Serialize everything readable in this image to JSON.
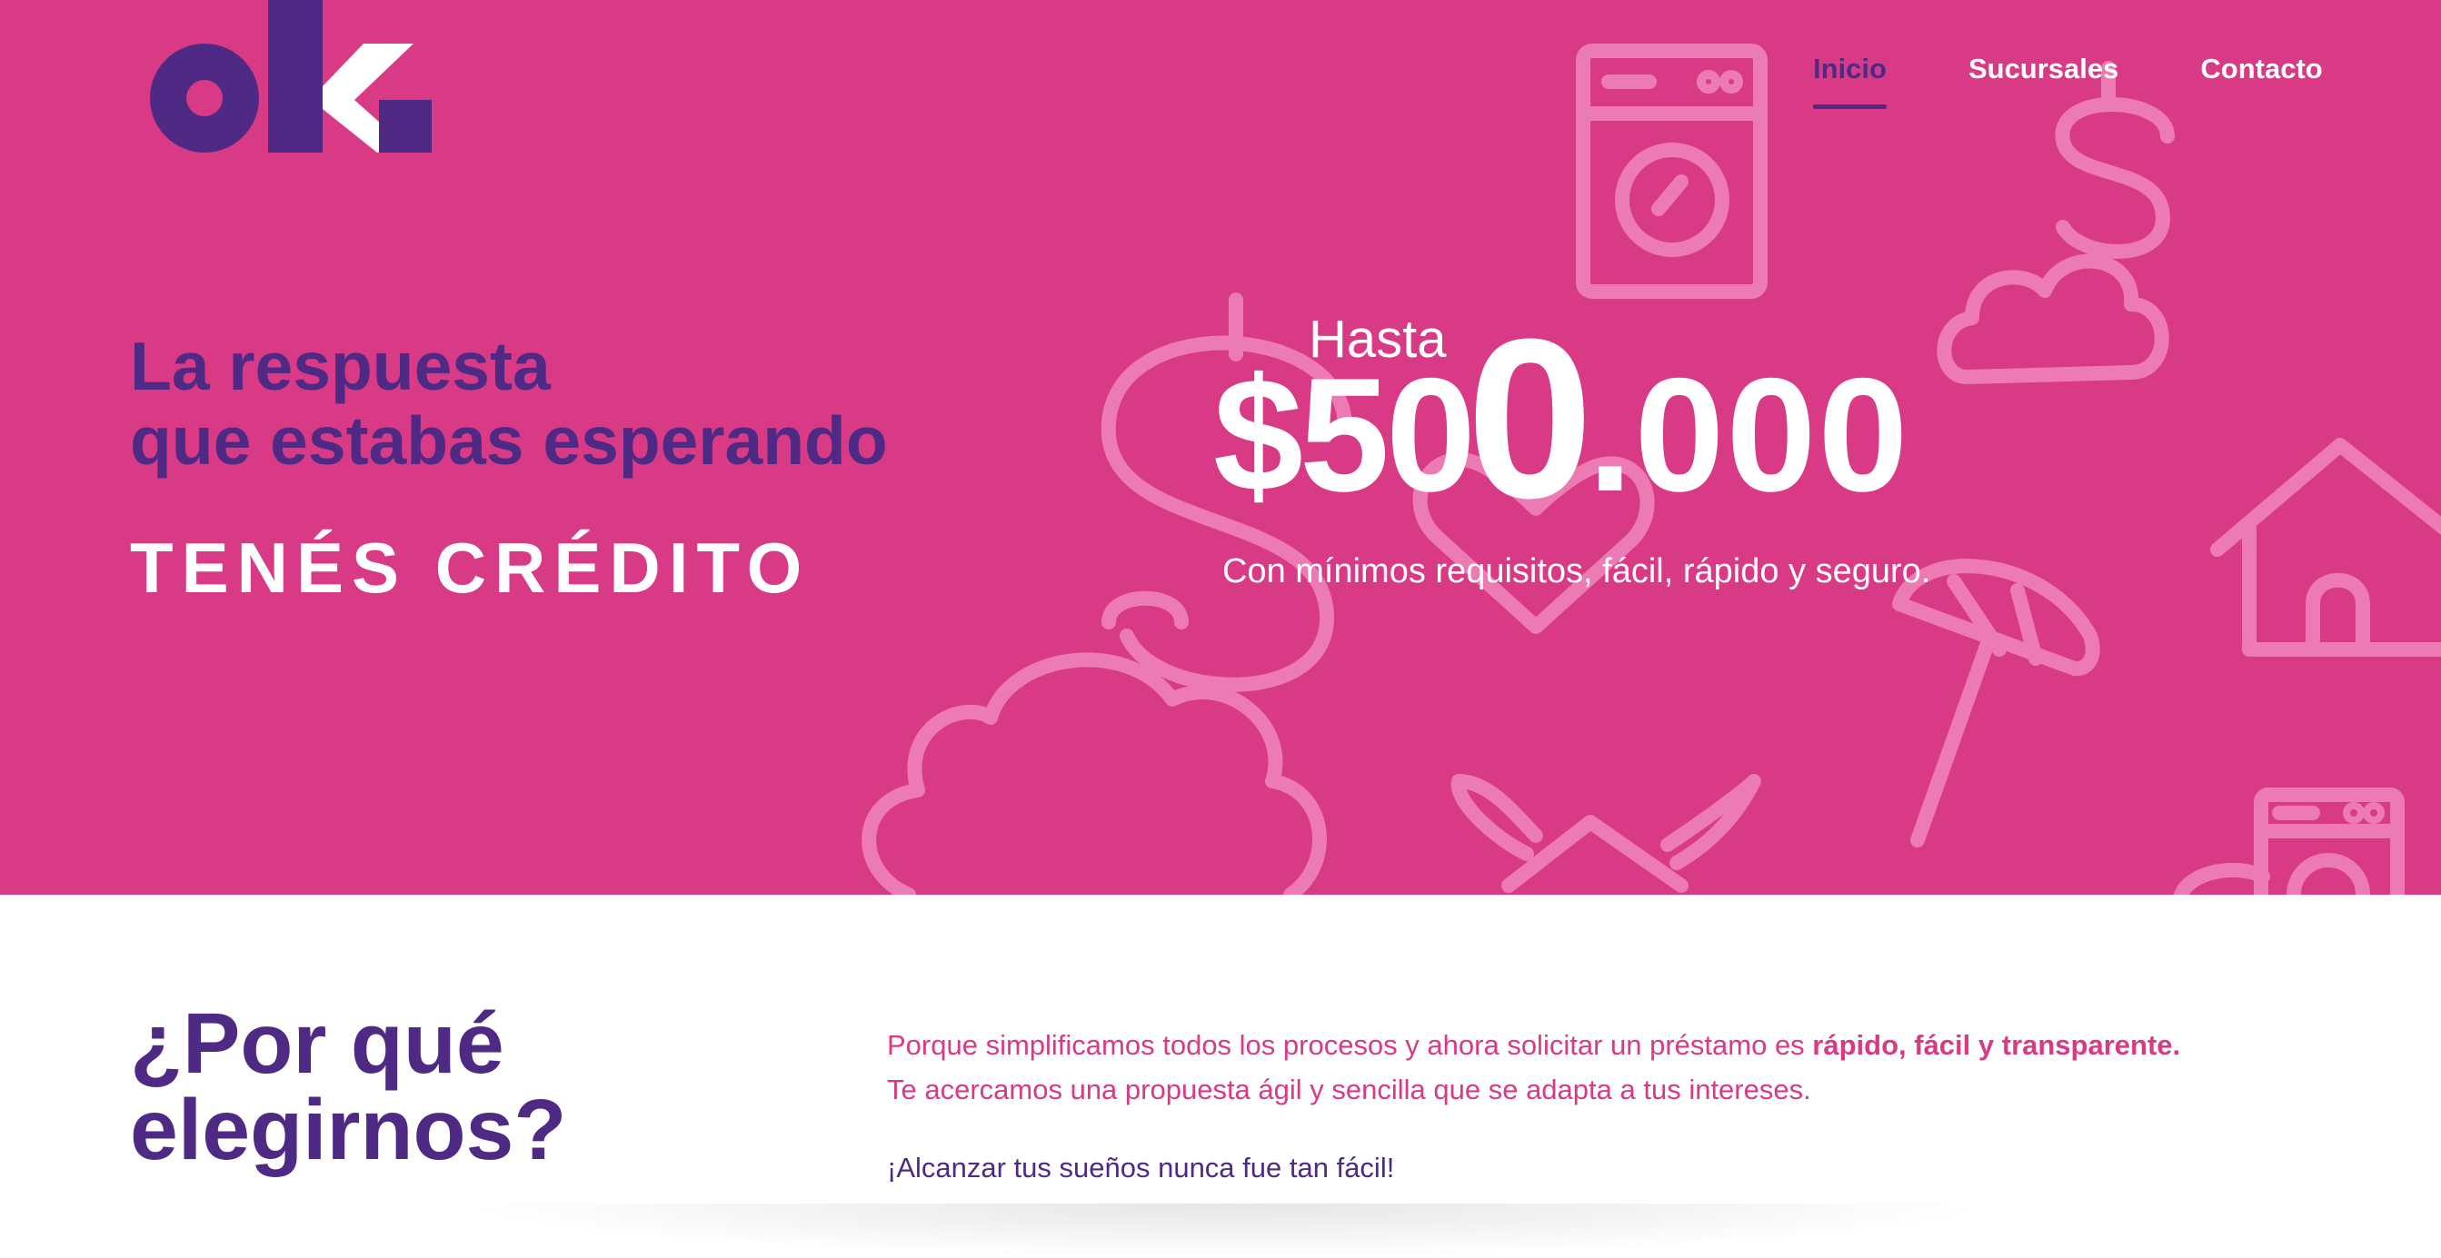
{
  "brand": {
    "logo_text": "ok.",
    "primary": "#d93a86",
    "secondary": "#4e2a84"
  },
  "nav": {
    "items": [
      "Inicio",
      "Sucursales",
      "Contacto"
    ],
    "active": "Inicio"
  },
  "hero": {
    "tagline_line1": "La respuesta",
    "tagline_line2": "que estabas esperando",
    "credito": "TENÉS CRÉDITO",
    "hasta": "Hasta",
    "amount_a": "$50",
    "amount_b": "0",
    "amount_c": ".000",
    "subtitle": "Con mínimos requisitos, fácil, rápido y seguro."
  },
  "why": {
    "title_line1": "¿Por qué",
    "title_line2": "elegirnos?",
    "line1_prefix": "Porque simplificamos todos los procesos y ahora solicitar un préstamo es ",
    "line1_bold": "rápido, fácil y transparente.",
    "line2": "Te acercamos una propuesta ágil y sencilla que se adapta a tus intereses.",
    "line3": "¡Alcanzar tus sueños nunca fue tan fácil!"
  }
}
